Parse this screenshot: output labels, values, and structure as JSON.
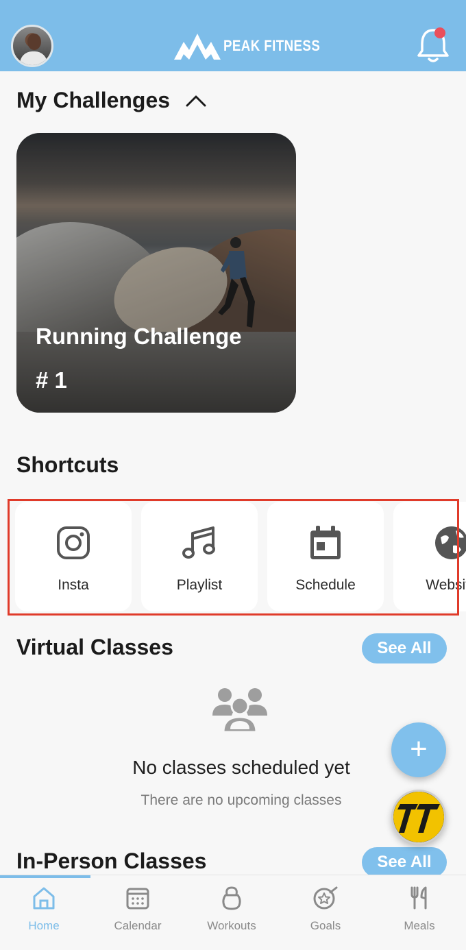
{
  "header": {
    "brand": "PEAK FITNESS",
    "avatar_icon": "user-avatar",
    "notification_icon": "bell-icon",
    "has_unread_notification": true,
    "accent_color": "#7dbde9"
  },
  "challenges": {
    "title": "My Challenges",
    "toggle_icon": "chevron-up-icon",
    "cards": [
      {
        "name": "Running Challenge",
        "number": "# 1"
      }
    ]
  },
  "shortcuts": {
    "title": "Shortcuts",
    "items": [
      {
        "label": "Insta",
        "icon": "instagram-icon"
      },
      {
        "label": "Playlist",
        "icon": "music-note-icon"
      },
      {
        "label": "Schedule",
        "icon": "calendar-icon"
      },
      {
        "label": "Website",
        "icon": "globe-icon"
      }
    ],
    "highlight_color": "#e03b2a"
  },
  "virtual_classes": {
    "title": "Virtual Classes",
    "see_all": "See All",
    "empty_icon": "people-group-icon",
    "empty_title": "No classes scheduled yet",
    "empty_subtitle": "There are no upcoming classes"
  },
  "in_person_classes": {
    "title": "In-Person Classes",
    "see_all": "See All"
  },
  "fabs": {
    "add_label": "+",
    "brand_icon": "trainerize-logo-icon"
  },
  "bottom_nav": {
    "items": [
      {
        "label": "Home",
        "icon": "home-icon",
        "active": true
      },
      {
        "label": "Calendar",
        "icon": "calendar-grid-icon",
        "active": false
      },
      {
        "label": "Workouts",
        "icon": "kettlebell-icon",
        "active": false
      },
      {
        "label": "Goals",
        "icon": "goal-star-icon",
        "active": false
      },
      {
        "label": "Meals",
        "icon": "fork-knife-icon",
        "active": false
      }
    ]
  }
}
